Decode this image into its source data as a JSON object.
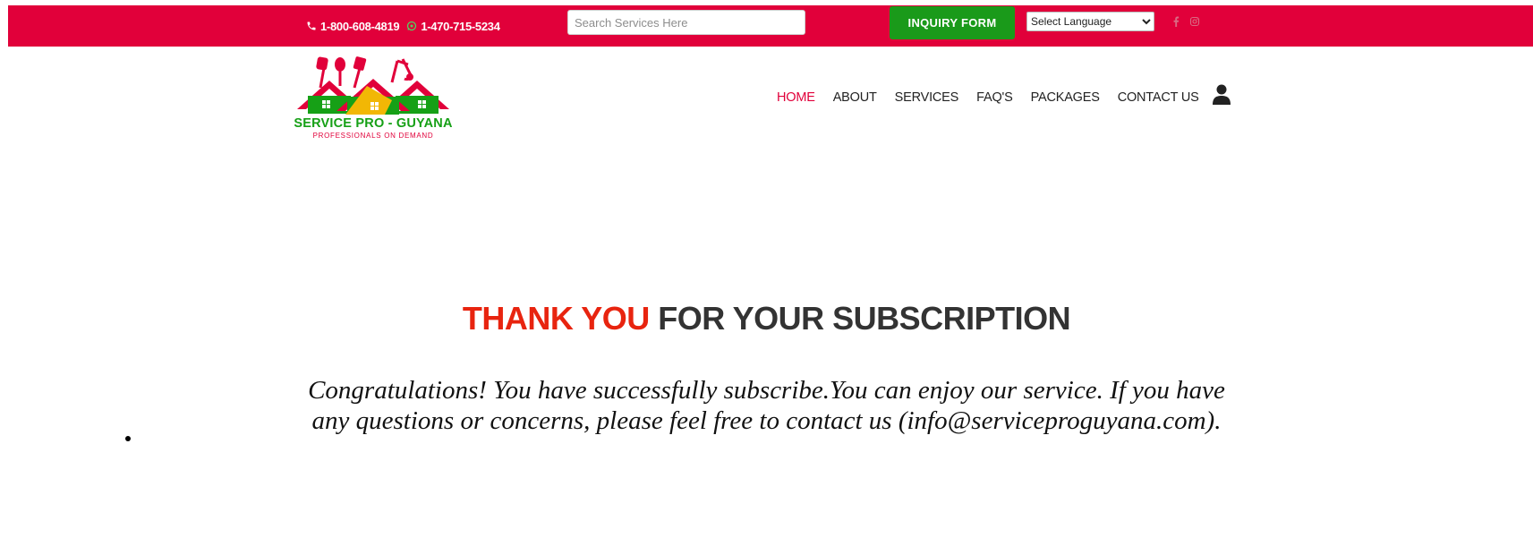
{
  "topbar": {
    "phone_tollfree": "1-800-608-4819",
    "phone_whatsapp": "1-470-715-5234",
    "search_placeholder": "Search Services Here",
    "inquiry_label": "INQUIRY FORM",
    "language_selected": "Select Language",
    "social_icons": [
      "facebook-icon",
      "instagram-icon"
    ]
  },
  "logo": {
    "title": "SERVICE PRO - GUYANA",
    "tagline": "PROFESSIONALS ON DEMAND"
  },
  "nav": {
    "items": [
      {
        "label": "HOME",
        "active": true
      },
      {
        "label": "ABOUT",
        "active": false
      },
      {
        "label": "SERVICES",
        "active": false
      },
      {
        "label": "FAQ'S",
        "active": false
      },
      {
        "label": "PACKAGES",
        "active": false
      },
      {
        "label": "CONTACT US",
        "active": false
      }
    ],
    "account_icon": "user-icon"
  },
  "main": {
    "heading_accent": "THANK YOU",
    "heading_rest": " FOR YOUR SUBSCRIPTION",
    "message": "Congratulations! You have successfully subscribe.You can enjoy our service. If you have any questions or concerns, please feel free to contact us (info@serviceproguyana.com)."
  },
  "colors": {
    "brand_red": "#e1003a",
    "brand_green": "#1a9a1a",
    "heading_accent": "#e8240f",
    "logo_yellow": "#f2b705"
  }
}
